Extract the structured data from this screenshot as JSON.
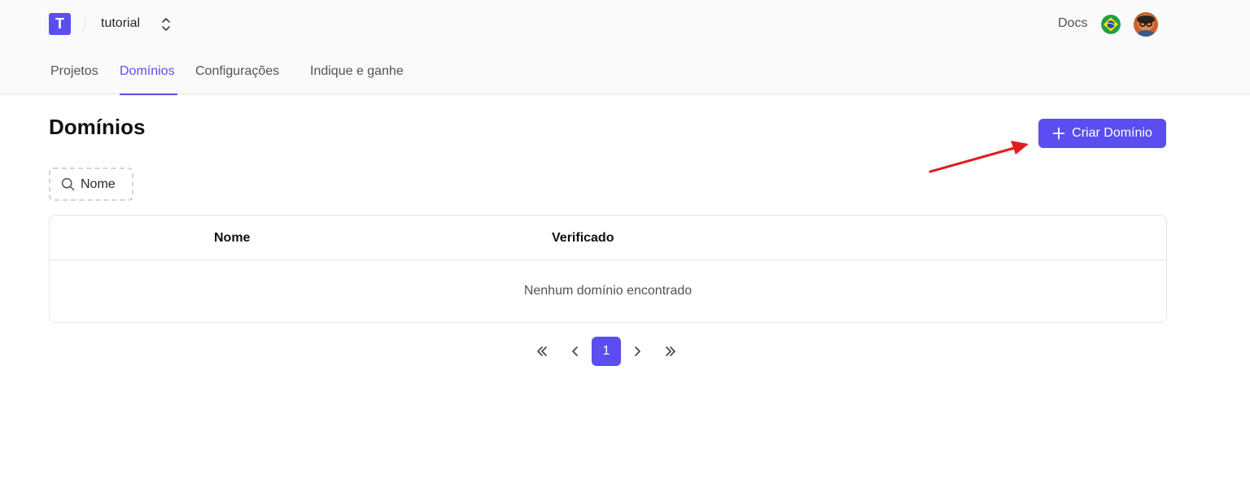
{
  "header": {
    "logo_letter": "T",
    "project_name": "tutorial",
    "docs_label": "Docs"
  },
  "tabs": [
    {
      "label": "Projetos",
      "active": false
    },
    {
      "label": "Domínios",
      "active": true
    },
    {
      "label": "Configurações",
      "active": false
    },
    {
      "label": "Indique e ganhe",
      "active": false
    }
  ],
  "page": {
    "title": "Domínios",
    "create_button_label": "Criar Domínio"
  },
  "search": {
    "placeholder": "Nome"
  },
  "table": {
    "columns": [
      "Nome",
      "Verificado"
    ],
    "empty_message": "Nenhum domínio encontrado"
  },
  "pagination": {
    "current_page": "1"
  },
  "colors": {
    "accent": "#5b4ef0",
    "annotation_arrow": "#e11d1d"
  },
  "icons": {
    "project_switch": "chevron-up-down-icon",
    "flag": "brazil-flag-icon",
    "search": "search-icon",
    "create": "plus-icon",
    "first": "chevrons-left-icon",
    "prev": "chevron-left-icon",
    "next": "chevron-right-icon",
    "last": "chevrons-right-icon"
  }
}
